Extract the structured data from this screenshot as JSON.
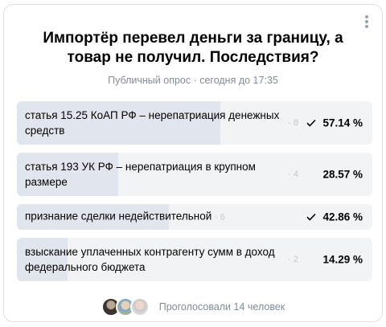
{
  "poll": {
    "title": "Импортёр перевел деньги за границу, а товар не получил. Последствия?",
    "meta": "Публичный опрос · сегодня до 17:35",
    "options": [
      {
        "label": "статья 15.25 КоАП РФ – нерепатриация денежных средств",
        "votes": "· 8",
        "percent": "57.14 %",
        "percent_value": 57.14,
        "checked": true
      },
      {
        "label": "статья 193 УК РФ – нерепатриация в крупном размере",
        "votes": "· 4",
        "percent": "28.57 %",
        "percent_value": 28.57,
        "checked": false
      },
      {
        "label": "признание сделки недействительной",
        "votes": "· 6",
        "percent": "42.86 %",
        "percent_value": 42.86,
        "checked": true
      },
      {
        "label": "взыскание уплаченных контрагенту сумм в доход федерального бюджета",
        "votes": "· 2",
        "percent": "14.29 %",
        "percent_value": 14.29,
        "checked": false
      }
    ],
    "footer": "Проголосовали 14 человек"
  },
  "icons": {
    "menu": "more-vertical-icon",
    "check": "check-icon"
  },
  "colors": {
    "fill": "#e1e6ee",
    "track": "#f2f3f5",
    "muted": "#818c99"
  }
}
